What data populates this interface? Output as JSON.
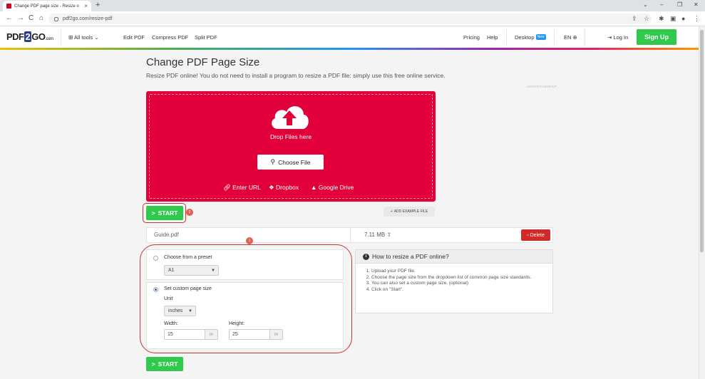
{
  "browser": {
    "tab_title": "Change PDF page size - Resize o",
    "tab_close": "×",
    "new_tab": "+",
    "url": "pdf2go.com/resize-pdf",
    "back": "←",
    "forward": "→",
    "reload": "C",
    "home": "⌂",
    "win_min": "–",
    "win_max": "❐",
    "win_close": "✕",
    "win_chevron": "⌄"
  },
  "header": {
    "logo_left": "PDF",
    "logo_mid": "2",
    "logo_right": "GO",
    "logo_suffix": ".com",
    "all_tools": "All tools",
    "edit_pdf": "Edit PDF",
    "compress_pdf": "Compress PDF",
    "split_pdf": "Split PDF",
    "pricing": "Pricing",
    "help": "Help",
    "desktop": "Desktop",
    "new_badge": "New",
    "language": "EN",
    "login": "Log In",
    "signup": "Sign Up"
  },
  "page": {
    "title": "Change PDF Page Size",
    "subtitle": "Resize PDF online! You do not need to install a program to resize a PDF file: simply use this free online service.",
    "ad_label": "ADVERTISEMENT"
  },
  "upload": {
    "drop_text": "Drop Files here",
    "choose_file": "Choose File",
    "enter_url": "Enter URL",
    "dropbox": "Dropbox",
    "google_drive": "Google Drive"
  },
  "actions": {
    "start": "START",
    "start_prefix": ">",
    "add_example": "ADD EXAMPLE FILE",
    "badge_2": "2",
    "badge_1": "1"
  },
  "file": {
    "name": "Guide.pdf",
    "size": "7.11 MB",
    "delete": "Delete"
  },
  "options": {
    "preset_label": "Choose from a preset",
    "preset_value": "A1",
    "custom_label": "Set custom page size",
    "unit_label": "Unit",
    "unit_value": "inches",
    "width_label": "Width:",
    "width_value": "15",
    "width_unit": "in",
    "height_label": "Height:",
    "height_value": "25",
    "height_unit": "in",
    "selected": "custom"
  },
  "howto": {
    "title": "How to resize a PDF online?",
    "steps": [
      "Upload your PDF file.",
      "Choose the page size from the dropdown list of common page size standards.",
      "You can also set a custom page size. (optional)",
      "Click on \"Start\"."
    ]
  },
  "colors": {
    "upload_bg": "#e2003b",
    "start_green": "#2fc94c",
    "delete_red": "#d22a2a",
    "annotation_red": "#c8333a"
  }
}
